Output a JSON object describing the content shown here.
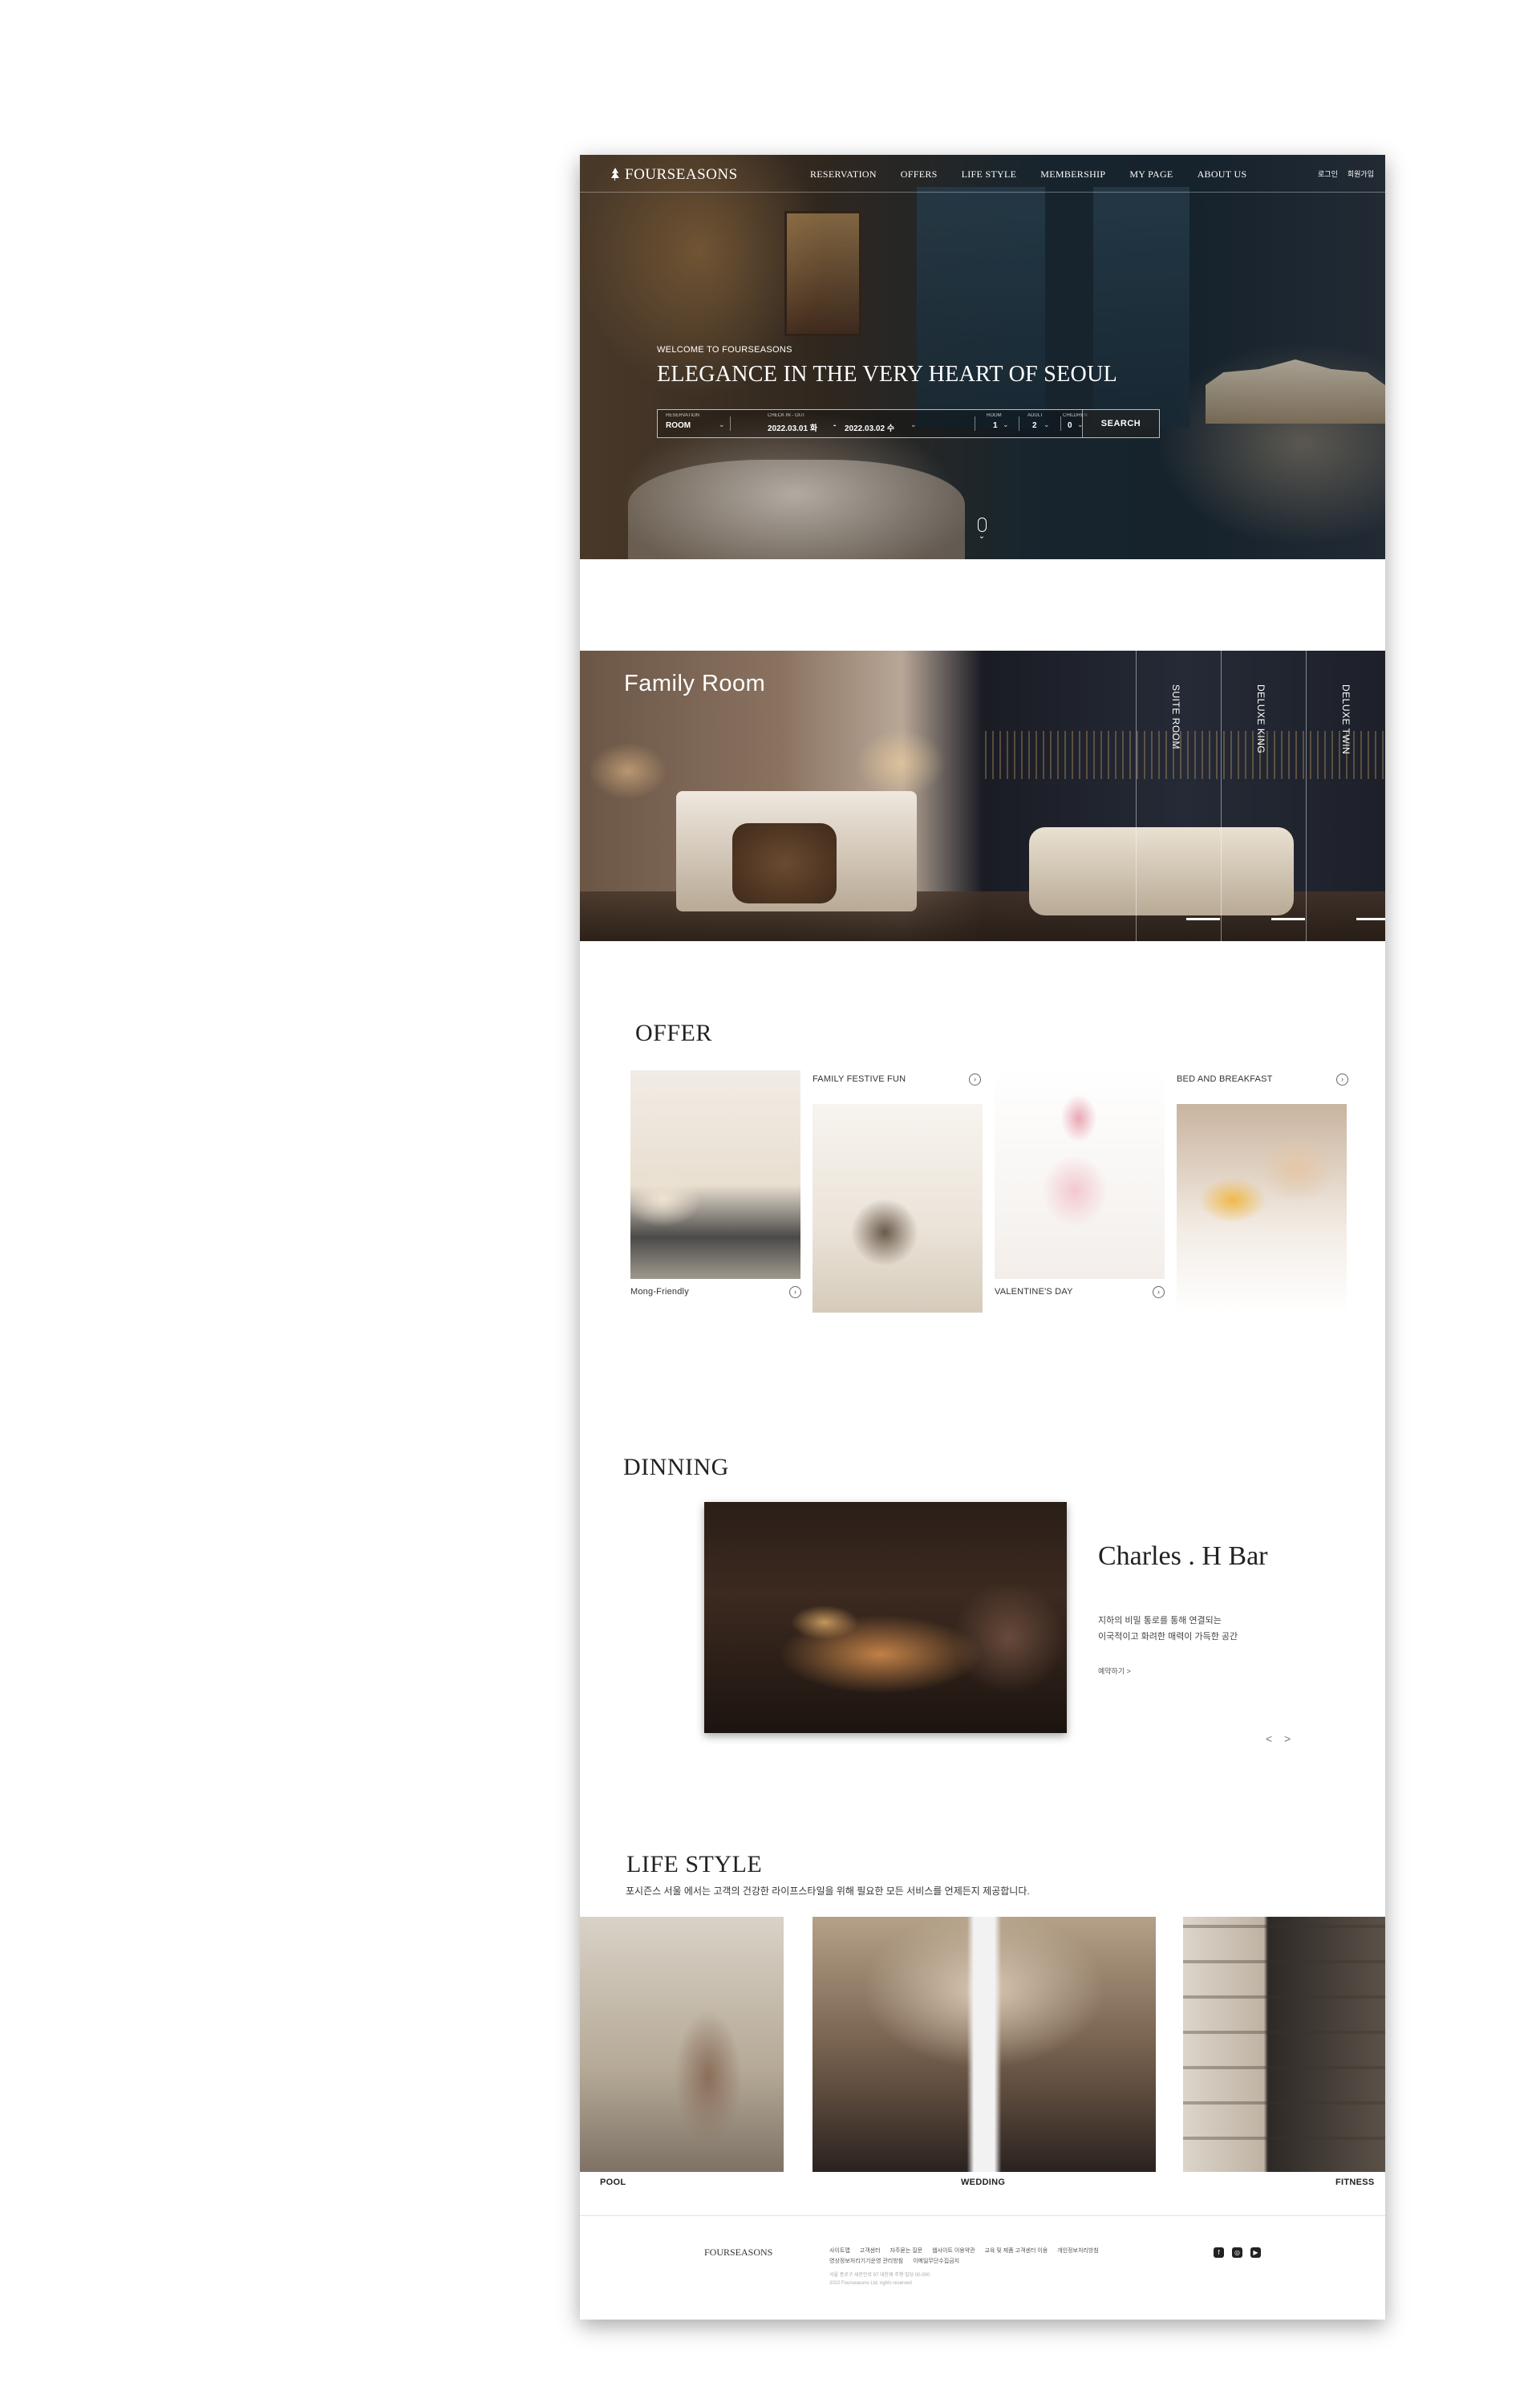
{
  "brand": {
    "name": "FOURSEASONS"
  },
  "nav": [
    "RESERVATION",
    "OFFERS",
    "LIFE STYLE",
    "MEMBERSHIP",
    "MY PAGE",
    "ABOUT US"
  ],
  "utility": [
    "로그인",
    "회원가입"
  ],
  "hero": {
    "welcome": "WELCOME TO FOURSEASONS",
    "title": "ELEGANCE IN THE VERY HEART OF SEOUL"
  },
  "booking": {
    "room_label": "RESERVATION",
    "room_value": "ROOM",
    "date_label": "CHECK IN - OUT",
    "checkin": "2022.03.01 화",
    "dash": "-",
    "checkout": "2022.03.02 수",
    "rooms_label": "ROOM",
    "rooms_value": "1",
    "adults_label": "ADULT",
    "adults_value": "2",
    "children_label": "CHILDREN",
    "children_value": "0",
    "search": "SEARCH"
  },
  "rooms": {
    "active": "Family Room",
    "tabs": [
      "SUITE ROOM",
      "DELUXE KING",
      "DELUXE TWIN"
    ]
  },
  "offer": {
    "title": "OFFER",
    "cards": [
      {
        "label": "Mong-Friendly"
      },
      {
        "label": "FAMILY FESTIVE FUN"
      },
      {
        "label": "VALENTINE'S DAY"
      },
      {
        "label": "BED AND BREAKFAST"
      }
    ]
  },
  "dining": {
    "title": "DINNING",
    "name": "Charles . H Bar",
    "desc_line1": "지하의 비밀 통로를 통해 연결되는",
    "desc_line2": "이국적이고 화려한 매력이 가득한 공간",
    "link": "예약하기  >",
    "prev": "<",
    "next": ">"
  },
  "lifestyle": {
    "title": "LIFE STYLE",
    "subtitle": "포시즌스 서울 에서는 고객의 건강한 라이프스타일을 위해 필요한 모든 서비스를 언제든지 제공합니다.",
    "items": [
      "POOL",
      "WEDDING",
      "FITNESS"
    ]
  },
  "footer": {
    "logo": "FOURSEASONS",
    "links": [
      "사이트맵",
      "고객센터",
      "자주묻는 질문",
      "웹사이트 이용약관",
      "교육 및 제품 고객센터 이용",
      "개인정보처리방침",
      "영상정보처리기기운영 관리방침",
      "이메일무단수집금지"
    ],
    "meta1": "서울 종로구 새문안로 97 대한제 주행 빌딩 00-000",
    "meta2": "2022 Fourseasons Ltd. rights reserved",
    "sns": [
      "f",
      "◎",
      "▶"
    ]
  },
  "colors": {
    "accent": "#222222",
    "hero_overlay": "#1b2a36"
  }
}
